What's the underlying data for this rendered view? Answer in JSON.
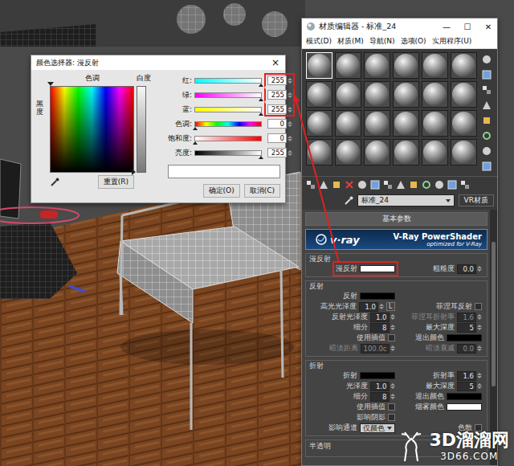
{
  "color_picker": {
    "title": "颜色选择器: 漫反射",
    "close": "×",
    "hue_label": "色调",
    "whiteness_label": "白度",
    "blackness_label": "黑度",
    "hue_marker": {
      "level": 0
    },
    "whiteness_marker": {
      "level": 1
    },
    "reset": "重置(R)",
    "sliders": [
      {
        "kind": "red",
        "label": "红:",
        "value": "255",
        "level": 1,
        "annotated": true
      },
      {
        "kind": "green",
        "label": "绿:",
        "value": "255",
        "level": 1,
        "annotated": true
      },
      {
        "kind": "blue",
        "label": "蓝:",
        "value": "255",
        "level": 1,
        "annotated": true
      },
      {
        "kind": "hue",
        "label": "色调:",
        "value": "0",
        "level": 0,
        "annotated": false
      },
      {
        "kind": "saturation",
        "label": "饱和度:",
        "value": "0",
        "level": 0,
        "annotated": false
      },
      {
        "kind": "brightness",
        "label": "亮度:",
        "value": "255",
        "level": 1,
        "annotated": false
      }
    ],
    "swatch": {
      "color": "#ffffff"
    },
    "buttons": [
      "确定(O)",
      "取消(C)"
    ]
  },
  "material_editor": {
    "title": "材质编辑器 - 标准_24",
    "controls": [
      "—",
      "☐",
      "✕"
    ],
    "menu": [
      "模式(D)",
      "材质(M)",
      "导航(N)",
      "选项(O)",
      "实用程序(U)"
    ],
    "slots": [
      {
        "selected": true
      },
      {
        "selected": false
      },
      {
        "selected": false
      },
      {
        "selected": false
      },
      {
        "selected": false
      },
      {
        "selected": false
      },
      {
        "selected": false
      },
      {
        "selected": false
      },
      {
        "selected": false
      },
      {
        "selected": false
      },
      {
        "selected": false
      },
      {
        "selected": false
      },
      {
        "selected": false
      },
      {
        "selected": false
      },
      {
        "selected": false
      },
      {
        "selected": false
      },
      {
        "selected": false
      },
      {
        "selected": false
      },
      {
        "selected": false
      },
      {
        "selected": false
      },
      {
        "selected": false
      },
      {
        "selected": false
      },
      {
        "selected": false
      },
      {
        "selected": false
      }
    ],
    "name": "标准_24",
    "type": "VR材质",
    "rollout": "基本参数",
    "banner": {
      "logo": "v·ray",
      "title": "V-Ray PowerShader",
      "subtitle": "optimized for V-Ray"
    },
    "groups": [
      {
        "title": "漫反射",
        "rows": [
          [
            {
              "kind": "color",
              "label": "漫反射",
              "color": "#ffffff",
              "disabled": false,
              "annotated": true
            },
            {
              "kind": "spinner",
              "label": "粗糙度",
              "value": "0.0",
              "disabled": false,
              "annotated": false
            }
          ]
        ]
      },
      {
        "title": "反射",
        "rows": [
          [
            {
              "kind": "color",
              "label": "反射",
              "color": "#000000",
              "disabled": false,
              "annotated": false
            }
          ],
          [
            {
              "kind": "spinner",
              "label": "高光光泽度",
              "value": "1.0",
              "button": "L",
              "disabled": false,
              "annotated": false
            },
            {
              "kind": "checkbox",
              "label": "菲涅耳反射",
              "checked": false,
              "disabled": false,
              "annotated": false
            }
          ],
          [
            {
              "kind": "spinner",
              "label": "反射光泽度",
              "value": "1.0",
              "disabled": false,
              "annotated": false
            },
            {
              "kind": "spinner",
              "label": "菲涅耳折射率",
              "value": "1.6",
              "disabled": true,
              "annotated": false
            }
          ],
          [
            {
              "kind": "spinner",
              "label": "细分",
              "value": "8",
              "disabled": false,
              "annotated": false
            },
            {
              "kind": "spinner",
              "label": "最大深度",
              "value": "5",
              "disabled": false,
              "annotated": false
            }
          ],
          [
            {
              "kind": "checkbox",
              "label": "使用插值",
              "checked": false,
              "disabled": false,
              "annotated": false
            },
            {
              "kind": "color",
              "label": "退出颜色",
              "color": "#000000",
              "disabled": false,
              "annotated": false
            }
          ],
          [
            {
              "kind": "spinner",
              "label": "暗淡距离",
              "value": "100.0c",
              "disabled": true,
              "annotated": false
            },
            {
              "kind": "spinner",
              "label": "暗淡衰减",
              "value": "0.0",
              "disabled": true,
              "annotated": false
            }
          ]
        ]
      },
      {
        "title": "折射",
        "rows": [
          [
            {
              "kind": "color",
              "label": "折射",
              "color": "#000000",
              "disabled": false,
              "annotated": false
            },
            {
              "kind": "spinner",
              "label": "折射率",
              "value": "1.6",
              "disabled": false,
              "annotated": false
            }
          ],
          [
            {
              "kind": "spinner",
              "label": "光泽度",
              "value": "1.0",
              "disabled": false,
              "annotated": false
            },
            {
              "kind": "spinner",
              "label": "最大深度",
              "value": "5",
              "disabled": false,
              "annotated": false
            }
          ],
          [
            {
              "kind": "spinner",
              "label": "细分",
              "value": "8",
              "disabled": false,
              "annotated": false
            },
            {
              "kind": "color",
              "label": "退出颜色",
              "color": "#000000",
              "disabled": false,
              "annotated": false
            }
          ],
          [
            {
              "kind": "checkbox",
              "label": "使用插值",
              "checked": false,
              "disabled": false,
              "annotated": false
            },
            {
              "kind": "color",
              "label": "烟雾颜色",
              "color": "#ffffff",
              "disabled": false,
              "annotated": false
            }
          ],
          [
            {
              "kind": "checkbox",
              "label": "影响阴影",
              "checked": false,
              "disabled": false,
              "annotated": false
            }
          ],
          [
            {
              "kind": "dropdown",
              "label": "影响通道",
              "value": "仅颜色",
              "disabled": false,
              "annotated": false
            },
            {
              "kind": "checkbox",
              "label": "色散",
              "checked": false,
              "disabled": false,
              "annotated": false
            }
          ]
        ]
      }
    ],
    "collapsed_group": "半透明"
  },
  "watermark": {
    "site": "3D溜溜网",
    "domain": "3D66.COM"
  }
}
